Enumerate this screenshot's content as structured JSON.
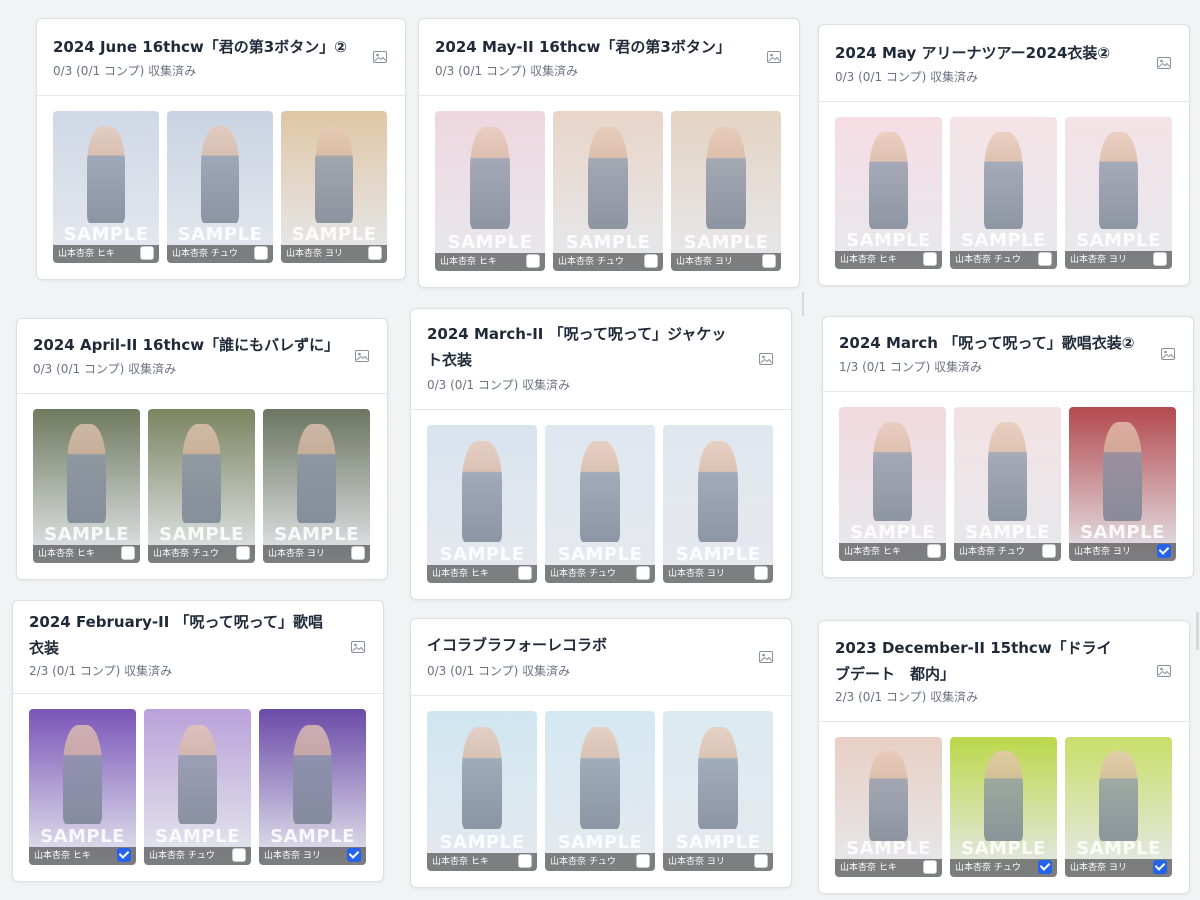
{
  "colors": {
    "accent": "#2563eb",
    "card_bg": "#ffffff",
    "page_bg": "#f2f3f5",
    "sub_text": "#6b7280"
  },
  "icon": "image-icon",
  "sample_text": "SAMPLE",
  "cards": [
    {
      "title": "2024 June 16thcw「君の第3ボタン」②",
      "status": "0/3 (0/1 コンプ) 収集済み",
      "photos": [
        {
          "label": "山本杏奈 ヒキ",
          "checked": false,
          "tint": "#cfd8e6"
        },
        {
          "label": "山本杏奈 チュウ",
          "checked": false,
          "tint": "#c9d3e2"
        },
        {
          "label": "山本杏奈 ヨリ",
          "checked": false,
          "tint": "#e0c7a6"
        }
      ]
    },
    {
      "title": "2024 May-II 16thcw「君の第3ボタン」",
      "status": "0/3 (0/1 コンプ) 収集済み",
      "photos": [
        {
          "label": "山本杏奈 ヒキ",
          "checked": false,
          "tint": "#efd7df"
        },
        {
          "label": "山本杏奈 チュウ",
          "checked": false,
          "tint": "#e8d5c8"
        },
        {
          "label": "山本杏奈 ヨリ",
          "checked": false,
          "tint": "#e4d3c2"
        }
      ]
    },
    {
      "title": "2024 May アリーナツアー2024衣装②",
      "status": "0/3 (0/1 コンプ) 収集済み",
      "photos": [
        {
          "label": "山本杏奈 ヒキ",
          "checked": false,
          "tint": "#f6dde4"
        },
        {
          "label": "山本杏奈 チュウ",
          "checked": false,
          "tint": "#f4e3e6"
        },
        {
          "label": "山本杏奈 ヨリ",
          "checked": false,
          "tint": "#f3e2e6"
        }
      ]
    },
    {
      "title": "2024 April-II 16thcw「誰にもバレずに」",
      "status": "0/3 (0/1 コンプ) 収集済み",
      "photos": [
        {
          "label": "山本杏奈 ヒキ",
          "checked": false,
          "tint": "#6f7a5f"
        },
        {
          "label": "山本杏奈 チュウ",
          "checked": false,
          "tint": "#7a8560"
        },
        {
          "label": "山本杏奈 ヨリ",
          "checked": false,
          "tint": "#6c7560"
        }
      ]
    },
    {
      "title": "2024 March-II 「呪って呪って」ジャケット衣装",
      "status": "0/3 (0/1 コンプ) 収集済み",
      "photos": [
        {
          "label": "山本杏奈 ヒキ",
          "checked": false,
          "tint": "#d9e3ee"
        },
        {
          "label": "山本杏奈 チュウ",
          "checked": false,
          "tint": "#dfe7f0"
        },
        {
          "label": "山本杏奈 ヨリ",
          "checked": false,
          "tint": "#e1e7ef"
        }
      ]
    },
    {
      "title": "2024 March 「呪って呪って」歌唱衣装②",
      "status": "1/3 (0/1 コンプ) 収集済み",
      "photos": [
        {
          "label": "山本杏奈 ヒキ",
          "checked": false,
          "tint": "#f1d9de"
        },
        {
          "label": "山本杏奈 チュウ",
          "checked": false,
          "tint": "#f3e2e3"
        },
        {
          "label": "山本杏奈 ヨリ",
          "checked": true,
          "tint": "#b34a4e"
        }
      ]
    },
    {
      "title": "2024 February-II 「呪って呪って」歌唱衣装",
      "status": "2/3 (0/1 コンプ) 収集済み",
      "photos": [
        {
          "label": "山本杏奈 ヒキ",
          "checked": true,
          "tint": "#7a55b8"
        },
        {
          "label": "山本杏奈 チュウ",
          "checked": false,
          "tint": "#b9a2d9"
        },
        {
          "label": "山本杏奈 ヨリ",
          "checked": true,
          "tint": "#6b4aa8"
        }
      ]
    },
    {
      "title": "イコラブラフォーレコラボ",
      "status": "0/3 (0/1 コンプ) 収集済み",
      "photos": [
        {
          "label": "山本杏奈 ヒキ",
          "checked": false,
          "tint": "#cfe6f1"
        },
        {
          "label": "山本杏奈 チュウ",
          "checked": false,
          "tint": "#d4e8f2"
        },
        {
          "label": "山本杏奈 ヨリ",
          "checked": false,
          "tint": "#dbeaf1"
        }
      ]
    },
    {
      "title": "2023 December-II 15thcw「ドライブデート　都内」",
      "status": "2/3 (0/1 コンプ) 収集済み",
      "photos": [
        {
          "label": "山本杏奈 ヒキ",
          "checked": false,
          "tint": "#e8cfc4"
        },
        {
          "label": "山本杏奈 チュウ",
          "checked": true,
          "tint": "#bcd84a"
        },
        {
          "label": "山本杏奈 ヨリ",
          "checked": true,
          "tint": "#c9df6a"
        }
      ]
    }
  ]
}
